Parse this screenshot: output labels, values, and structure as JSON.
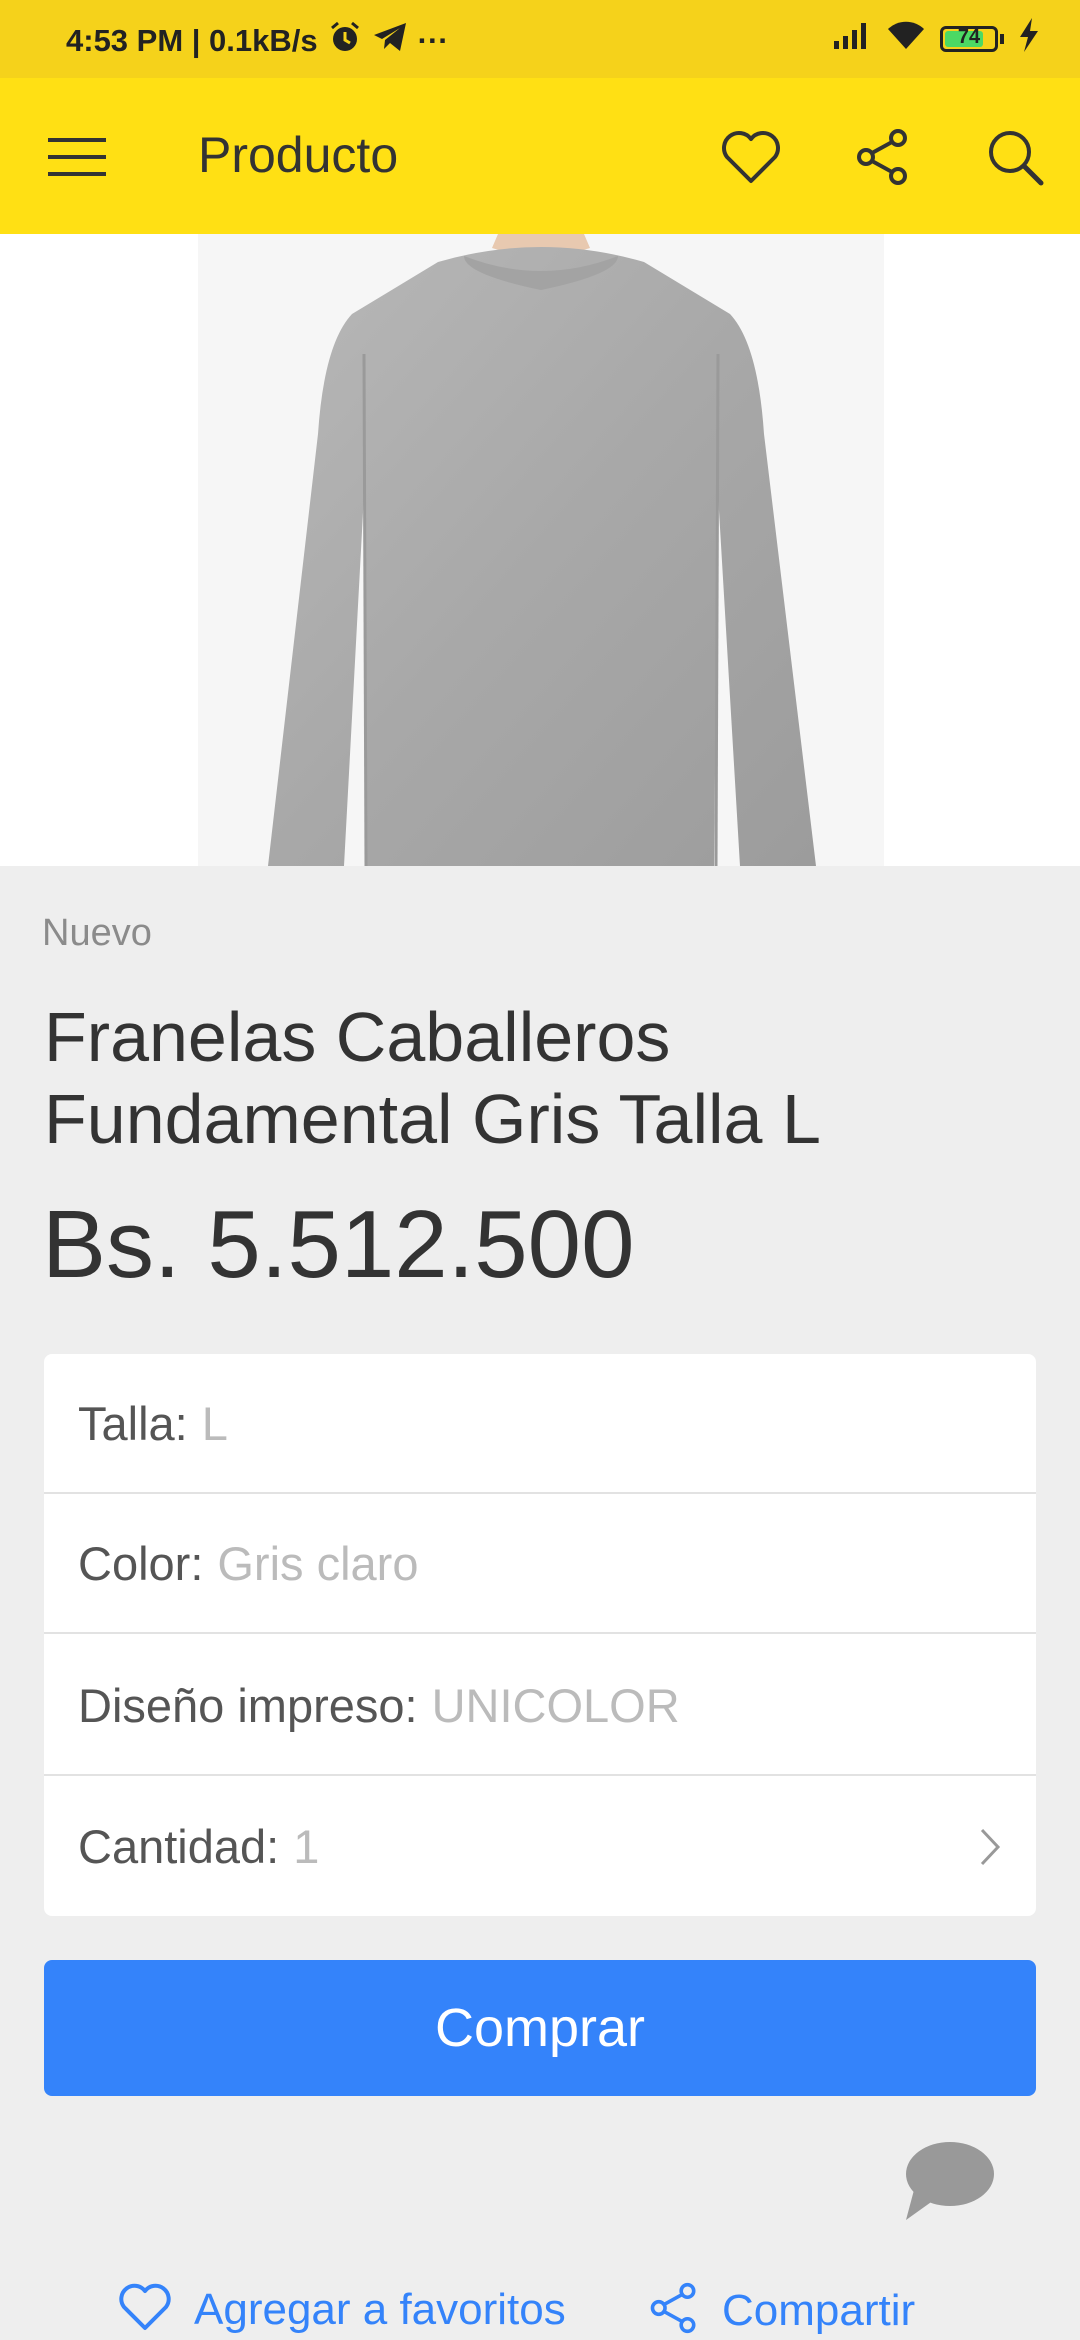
{
  "status_bar": {
    "time_speed": "4:53 PM | 0.1kB/s",
    "dots": "···",
    "battery": "74"
  },
  "toolbar": {
    "title": "Producto"
  },
  "product": {
    "condition": "Nuevo",
    "title": "Franelas Caballeros Fundamental Gris Talla L",
    "price": "Bs. 5.512.500"
  },
  "variations": [
    {
      "label": "Talla:",
      "value": "L"
    },
    {
      "label": "Color:",
      "value": "Gris claro"
    },
    {
      "label": "Diseño impreso:",
      "value": "UNICOLOR"
    },
    {
      "label": "Cantidad:",
      "value": "1"
    }
  ],
  "buy_button": "Comprar",
  "actions": {
    "favorite": "Agregar a favoritos",
    "share": "Compartir"
  },
  "colors": {
    "brand_yellow": "#ffe014",
    "primary_blue": "#3483fa"
  }
}
